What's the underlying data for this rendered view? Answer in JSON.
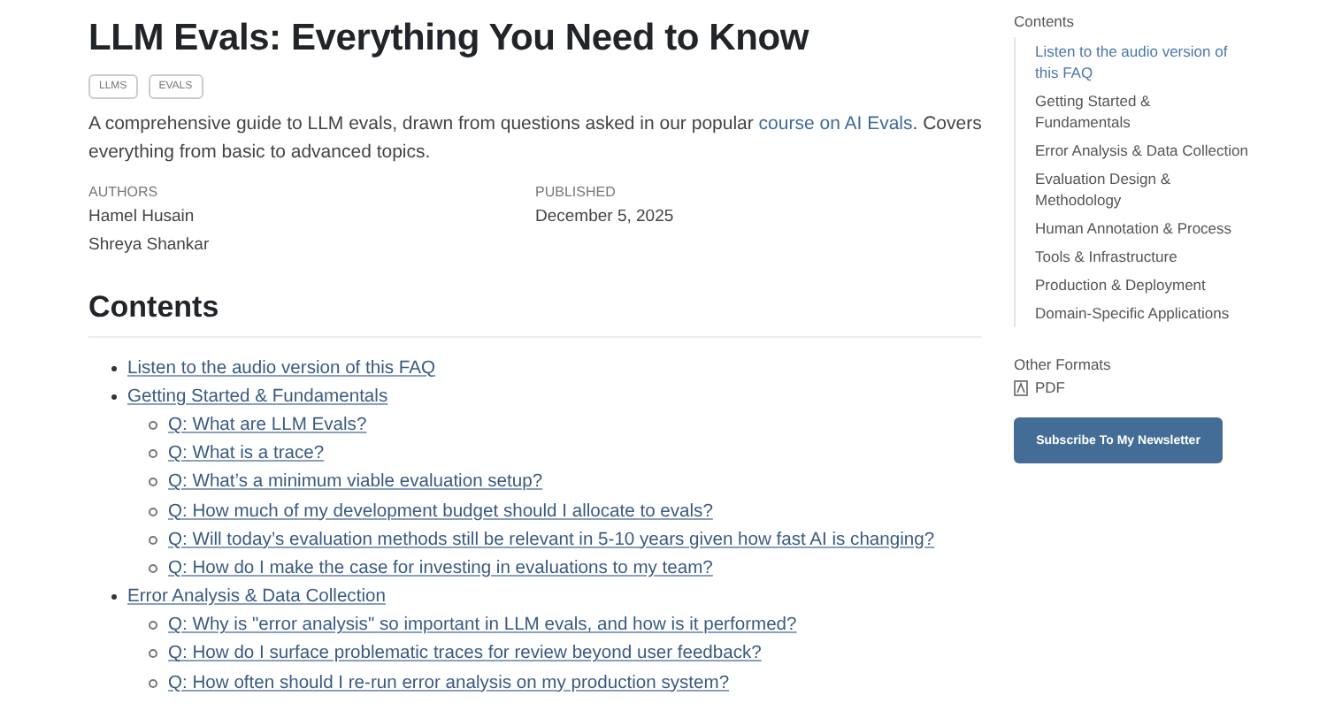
{
  "article": {
    "title": "LLM Evals: Everything You Need to Know",
    "tags": [
      "LLMS",
      "EVALS"
    ],
    "description": {
      "before": "A comprehensive guide to LLM evals, drawn from questions asked in our popular ",
      "link": "course on AI Evals",
      "after": ". Covers everything from basic to advanced topics."
    },
    "authors_label": "AUTHORS",
    "authors": [
      "Hamel Husain",
      "Shreya Shankar"
    ],
    "published_label": "PUBLISHED",
    "published": "December 5, 2025"
  },
  "contents": {
    "heading": "Contents",
    "items": [
      {
        "label": "Listen to the audio version of this FAQ"
      },
      {
        "label": "Getting Started & Fundamentals",
        "children": [
          "Q: What are LLM Evals?",
          "Q: What is a trace?",
          "Q: What’s a minimum viable evaluation setup?",
          "Q: How much of my development budget should I allocate to evals?",
          "Q: Will today’s evaluation methods still be relevant in 5-10 years given how fast AI is changing?",
          "Q: How do I make the case for investing in evaluations to my team?"
        ]
      },
      {
        "label": "Error Analysis & Data Collection",
        "children": [
          "Q: Why is \"error analysis\" so important in LLM evals, and how is it performed?",
          "Q: How do I surface problematic traces for review beyond user feedback?",
          "Q: How often should I re-run error analysis on my production system?"
        ]
      }
    ]
  },
  "sidebar": {
    "heading": "Contents",
    "items": [
      {
        "label": "Listen to the audio version of this FAQ",
        "selected": true
      },
      {
        "label": "Getting Started & Fundamentals",
        "selected": false
      },
      {
        "label": "Error Analysis & Data Collection",
        "selected": false
      },
      {
        "label": "Evaluation Design & Methodology",
        "selected": false
      },
      {
        "label": "Human Annotation & Process",
        "selected": false
      },
      {
        "label": "Tools & Infrastructure",
        "selected": false
      },
      {
        "label": "Production & Deployment",
        "selected": false
      },
      {
        "label": "Domain-Specific Applications",
        "selected": false
      }
    ],
    "other_formats_label": "Other Formats",
    "formats": [
      "PDF"
    ],
    "subscribe_button": "Subscribe To My Newsletter"
  }
}
